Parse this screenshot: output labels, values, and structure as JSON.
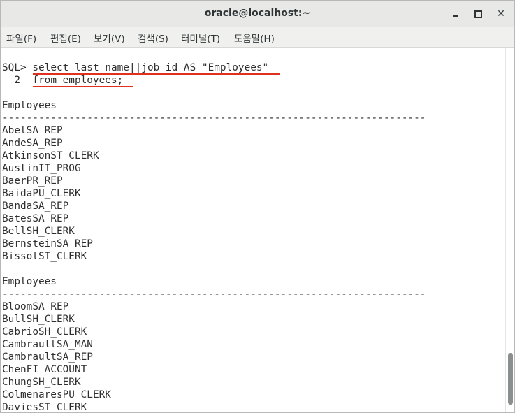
{
  "window": {
    "title": "oracle@localhost:~"
  },
  "menu": [
    "파일(F)",
    "편집(E)",
    "보기(V)",
    "검색(S)",
    "터미널(T)",
    "도움말(H)"
  ],
  "terminal": {
    "prompt": "SQL> ",
    "command_line1": "select last_name||job_id AS \"Employees\"",
    "line2_number": "  2  ",
    "command_line2": "from employees;",
    "heading": "Employees",
    "separator": "----------------------------------------------------------------------",
    "block1": [
      "AbelSA_REP",
      "AndeSA_REP",
      "AtkinsonST_CLERK",
      "AustinIT_PROG",
      "BaerPR_REP",
      "BaidaPU_CLERK",
      "BandaSA_REP",
      "BatesSA_REP",
      "BellSH_CLERK",
      "BernsteinSA_REP",
      "BissotST_CLERK"
    ],
    "block2": [
      "BloomSA_REP",
      "BullSH_CLERK",
      "CabrioSH_CLERK",
      "CambraultSA_MAN",
      "CambraultSA_REP",
      "ChenFI_ACCOUNT",
      "ChungSH_CLERK",
      "ColmenaresPU_CLERK",
      "DaviesST_CLERK"
    ]
  },
  "colors": {
    "underline": "#e0301e",
    "terminal_text": "#2e2e2e"
  }
}
